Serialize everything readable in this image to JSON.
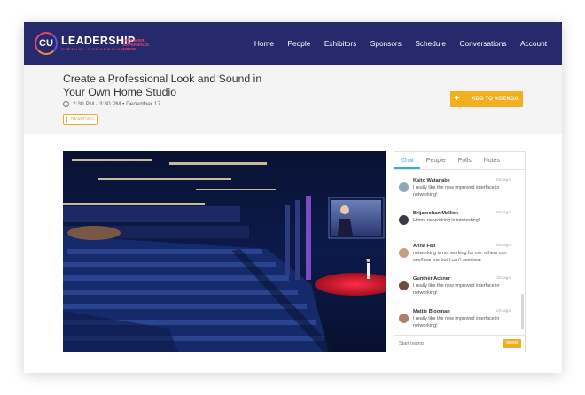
{
  "brand": {
    "logo_letters": "CU",
    "logo_main": "LEADERSHIP",
    "logo_sub": "VIRTUAL CONVENTION",
    "logo_tag_1": "DISCOVER.",
    "logo_tag_2": "EXPERIENCE.",
    "logo_tag_3": "GROW."
  },
  "nav": [
    "Home",
    "People",
    "Exhibitors",
    "Sponsors",
    "Schedule",
    "Conversations",
    "Account"
  ],
  "session": {
    "title": "Create a Professional Look and Sound in Your Own Home Studio",
    "time": "2:30 PM - 3:30 PM  •  December 17",
    "tag": "BRANDING",
    "agenda_plus": "+",
    "agenda_label": "ADD TO AGENDA"
  },
  "chat": {
    "tabs": [
      "Chat",
      "People",
      "Polls",
      "Notes"
    ],
    "messages": [
      {
        "name": "Kaito Watanabe",
        "time": "6m ago",
        "text": "I really like the new improved interface in networking!"
      },
      {
        "name": "Brijamohan Mallick",
        "time": "6m ago",
        "text": "Hmm, networking is interesting!"
      },
      {
        "name": "Anna Fali",
        "time": "6m ago",
        "text": "networking is not working for me. others can see/hear me but I can't see/hear"
      },
      {
        "name": "Gunther Ackner",
        "time": "3m ago",
        "text": "I really like the new improved interface in networking!"
      },
      {
        "name": "Mattie Blooman",
        "time": "2m ago",
        "text": "I really like the new improved interface in networking!"
      }
    ],
    "placeholder": "Start typing",
    "send": "SEND"
  },
  "colors": {
    "header": "#262a6c",
    "accent": "#f2b01e",
    "active_tab": "#2db0d8"
  }
}
